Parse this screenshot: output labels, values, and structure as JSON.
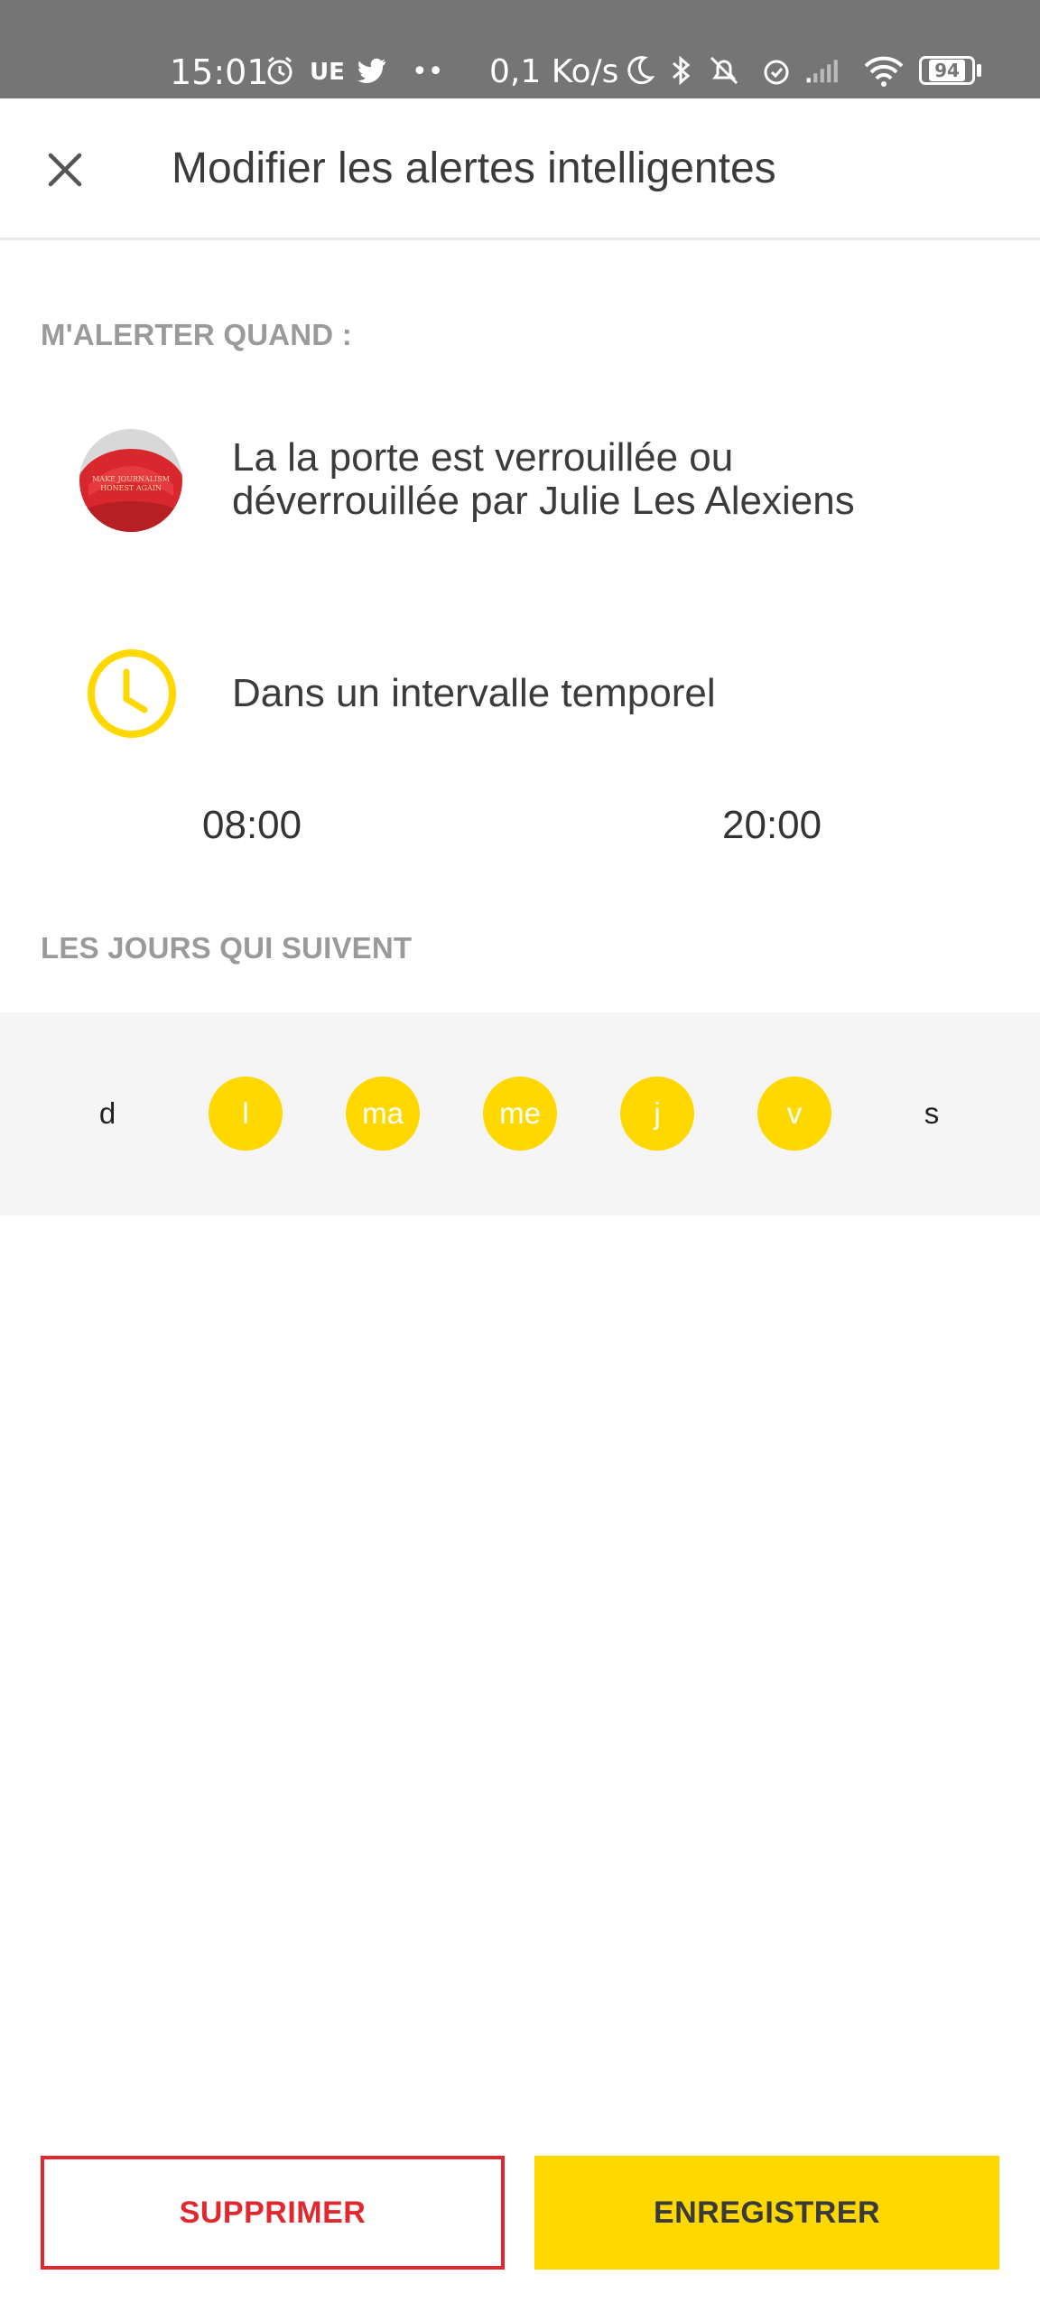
{
  "status_bar": {
    "time": "15:01",
    "carrier_badge": "UE",
    "dots": "••",
    "speed": "0,1 Ko/s",
    "battery": "94"
  },
  "header": {
    "title": "Modifier les alertes intelligentes"
  },
  "alert": {
    "section_label": "M'ALERTER QUAND :",
    "trigger_line1": "La la porte est verrouillée ou",
    "trigger_line2": "déverrouillée par Julie Les Alexiens",
    "cap_text_line1": "MAKE JOURNALISM",
    "cap_text_line2": "HONEST AGAIN",
    "time_window_label": "Dans un intervalle temporel",
    "start_time": "08:00",
    "end_time": "20:00"
  },
  "days": {
    "section_label": "LES JOURS QUI SUIVENT",
    "items": [
      {
        "label": "d",
        "selected": false
      },
      {
        "label": "l",
        "selected": true
      },
      {
        "label": "ma",
        "selected": true
      },
      {
        "label": "me",
        "selected": true
      },
      {
        "label": "j",
        "selected": true
      },
      {
        "label": "v",
        "selected": true
      },
      {
        "label": "s",
        "selected": false
      }
    ]
  },
  "actions": {
    "delete_label": "SUPPRIMER",
    "save_label": "ENREGISTRER"
  },
  "colors": {
    "accent": "#ffd800",
    "danger": "#e0282e",
    "status_bar": "#757575"
  }
}
